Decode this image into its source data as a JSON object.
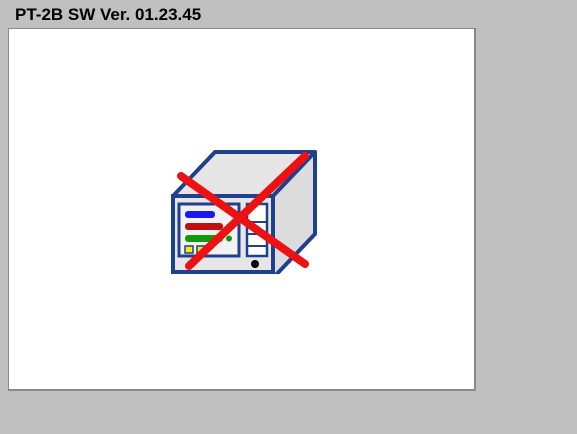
{
  "window": {
    "title": "PT-2B SW Ver. 01.23.45"
  },
  "status": {
    "icon": "device-disconnected-icon",
    "colors": {
      "device_outline": "#1f3f8f",
      "device_face": "#e8e8e8",
      "cross": "#ee1111",
      "bar_blue": "#1a1aee",
      "bar_red": "#bb1111",
      "bar_green": "#119911",
      "indicator_yellow": "#eeee11"
    }
  }
}
